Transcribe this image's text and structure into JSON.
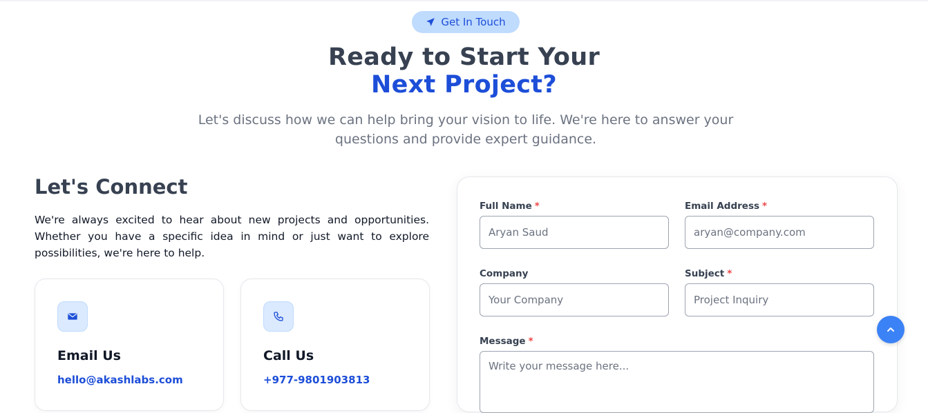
{
  "badge": {
    "icon": "send-icon",
    "label": "Get In Touch"
  },
  "hero": {
    "title_line1": "Ready to Start Your",
    "title_line2": "Next Project?",
    "subtitle": "Let's discuss how we can help bring your vision to life. We're here to answer your questions and provide expert guidance."
  },
  "connect": {
    "title": "Let's Connect",
    "text": "We're always excited to hear about new projects and opportunities. Whether you have a specific idea in mind or just want to explore possibilities, we're here to help."
  },
  "cards": [
    {
      "icon": "mail-icon",
      "title": "Email Us",
      "value": "hello@akashlabs.com"
    },
    {
      "icon": "phone-icon",
      "title": "Call Us",
      "value": "+977-9801903813"
    }
  ],
  "form": {
    "full_name": {
      "label": "Full Name",
      "required": "*",
      "placeholder": "Aryan Saud"
    },
    "email": {
      "label": "Email Address",
      "required": "*",
      "placeholder": "aryan@company.com"
    },
    "company": {
      "label": "Company",
      "placeholder": "Your Company"
    },
    "subject": {
      "label": "Subject",
      "required": "*",
      "placeholder": "Project Inquiry"
    },
    "message": {
      "label": "Message",
      "required": "*",
      "placeholder": "Write your message here..."
    }
  },
  "scroll_top": {
    "icon": "chevron-up-icon"
  },
  "colors": {
    "accent": "#1d4ed8",
    "badge_bg": "#bfdbfe",
    "required": "#ef4444",
    "scroll_btn": "#3b82f6"
  }
}
